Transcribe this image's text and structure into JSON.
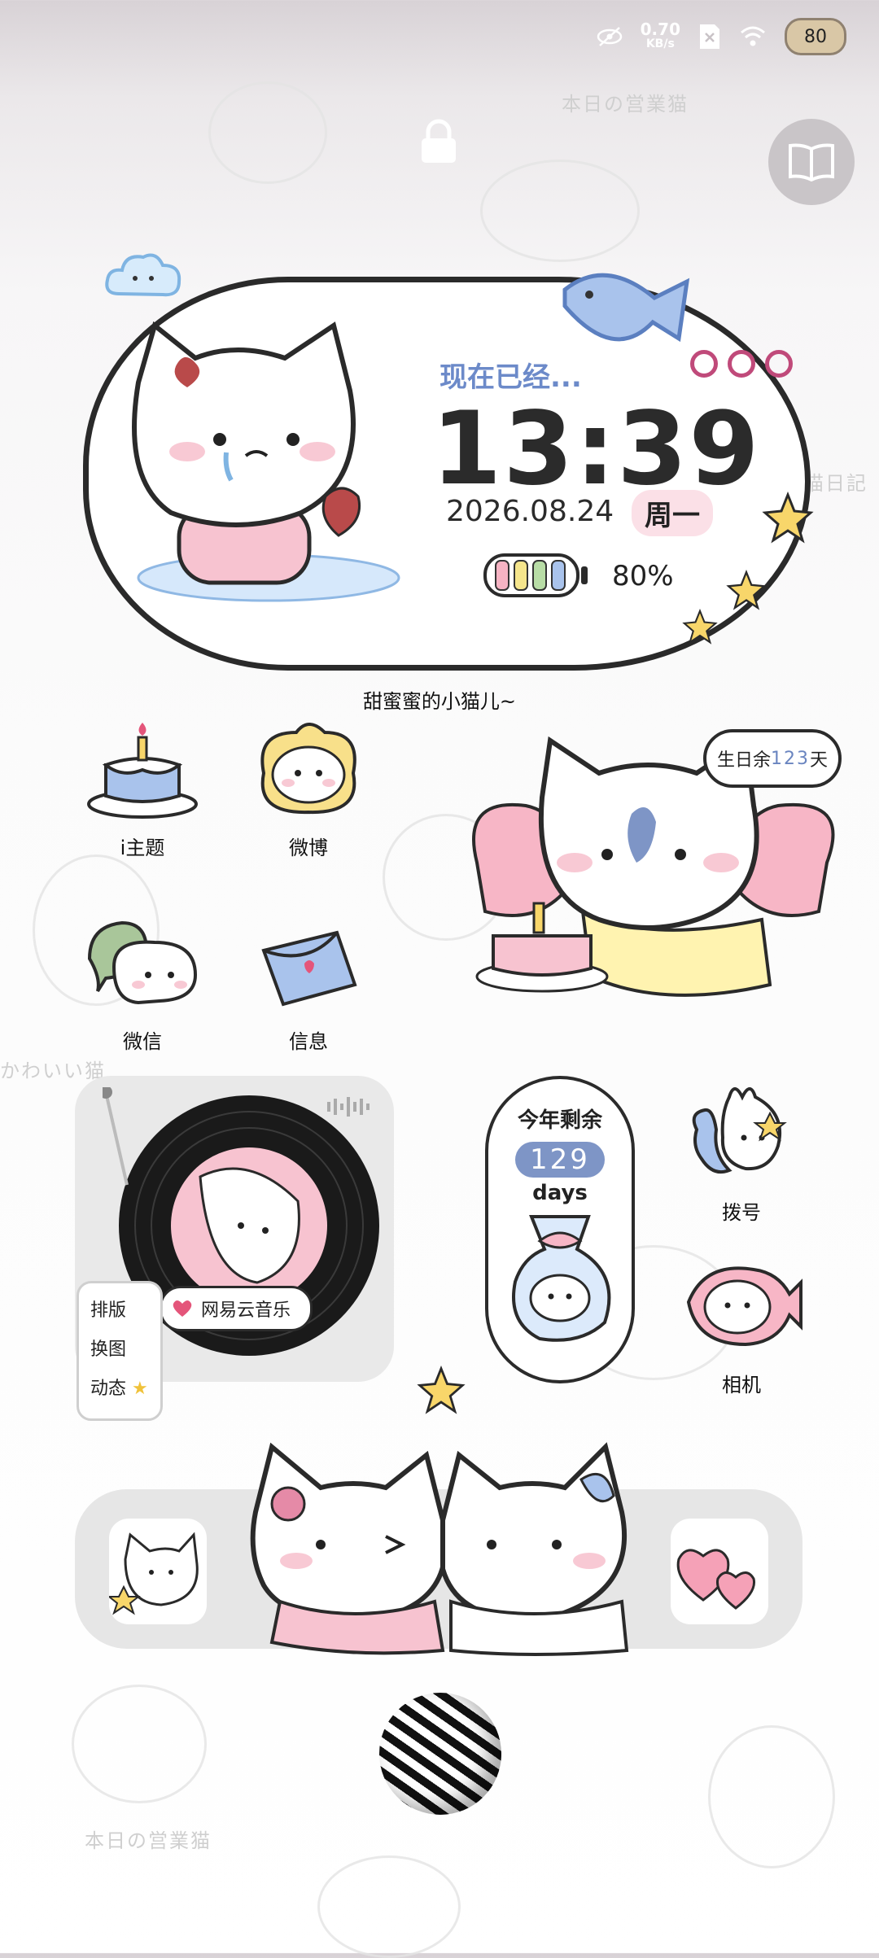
{
  "status_bar": {
    "speed_value": "0.70",
    "speed_unit": "KB/s",
    "battery_level": "80",
    "icons": [
      "eye-hidden-icon",
      "sim-x-icon",
      "wifi-icon",
      "battery-icon"
    ]
  },
  "lockscreen": {
    "lock_icon": "lock-icon",
    "book_icon": "book-icon"
  },
  "clock_widget": {
    "subtitle": "现在已经...",
    "time": "13:39",
    "date": "2026.08.24",
    "weekday": "周一",
    "battery_percent": "80%",
    "battery_fraction": 0.8,
    "battery_colors": [
      "#f6b3c3",
      "#f5e58c",
      "#b8dda6",
      "#a9c3ec"
    ]
  },
  "caption": "甜蜜蜜的小猫儿~",
  "apps": {
    "theme": "i主题",
    "weibo": "微博",
    "wechat": "微信",
    "messages": "信息",
    "dialer": "拨号",
    "camera": "相机"
  },
  "birthday_bubble": {
    "prefix": "生日余",
    "days": "123",
    "suffix": "天"
  },
  "music_widget": {
    "app_name": "网易云音乐",
    "menu": [
      "排版",
      "换图",
      "动态"
    ]
  },
  "countdown_widget": {
    "title": "今年剩余",
    "days": "129",
    "unit": "days"
  },
  "background": {
    "labels": [
      "本日の営業猫",
      "かわいい猫",
      "猫日記",
      "本日の営業猫"
    ]
  },
  "colors": {
    "accent_blue": "#6c8ac9",
    "pink": "#f7c3d0",
    "dark": "#2b2b2b"
  }
}
